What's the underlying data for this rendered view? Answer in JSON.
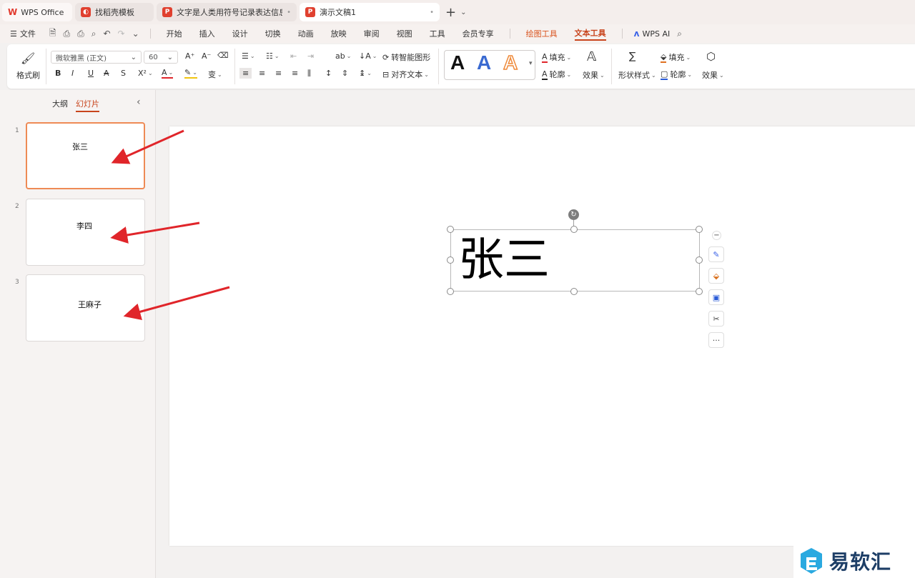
{
  "tabs": {
    "home": "WPS Office",
    "template": "找稻壳模板",
    "doc1": "文字是人类用符号记录表达信息以",
    "doc2": "演示文稿1",
    "add": "+",
    "more": "⌄",
    "dot": "•"
  },
  "menu": {
    "file": "文件",
    "items": [
      "开始",
      "插入",
      "设计",
      "切换",
      "动画",
      "放映",
      "审阅",
      "视图",
      "工具",
      "会员专享"
    ],
    "drawing_tools": "绘图工具",
    "text_tools": "文本工具",
    "wps_ai": "WPS AI"
  },
  "ribbon": {
    "format_painter": "格式刷",
    "font_name": "微软雅黑 (正文)",
    "font_size": "60",
    "smart_shape": "转智能图形",
    "align_text": "对齐文本",
    "fill": "填充",
    "outline": "轮廓",
    "effect": "效果",
    "shape_style": "形状样式",
    "shape_fill": "填充",
    "shape_outline": "轮廓",
    "shape_effect": "效果",
    "style_letter": "A"
  },
  "panel": {
    "outline_tab": "大纲",
    "slides_tab": "幻灯片",
    "collapse": "‹",
    "slides": [
      {
        "num": "1",
        "text": "张三"
      },
      {
        "num": "2",
        "text": "李四"
      },
      {
        "num": "3",
        "text": "王麻子"
      }
    ]
  },
  "canvas": {
    "textbox_text": "张三"
  },
  "float_tools": {
    "more": "···"
  },
  "watermark": {
    "text": "易软汇"
  },
  "colors": {
    "accent": "#c8441c",
    "arrow": "#e0252a",
    "wps_red": "#e23a2e"
  }
}
